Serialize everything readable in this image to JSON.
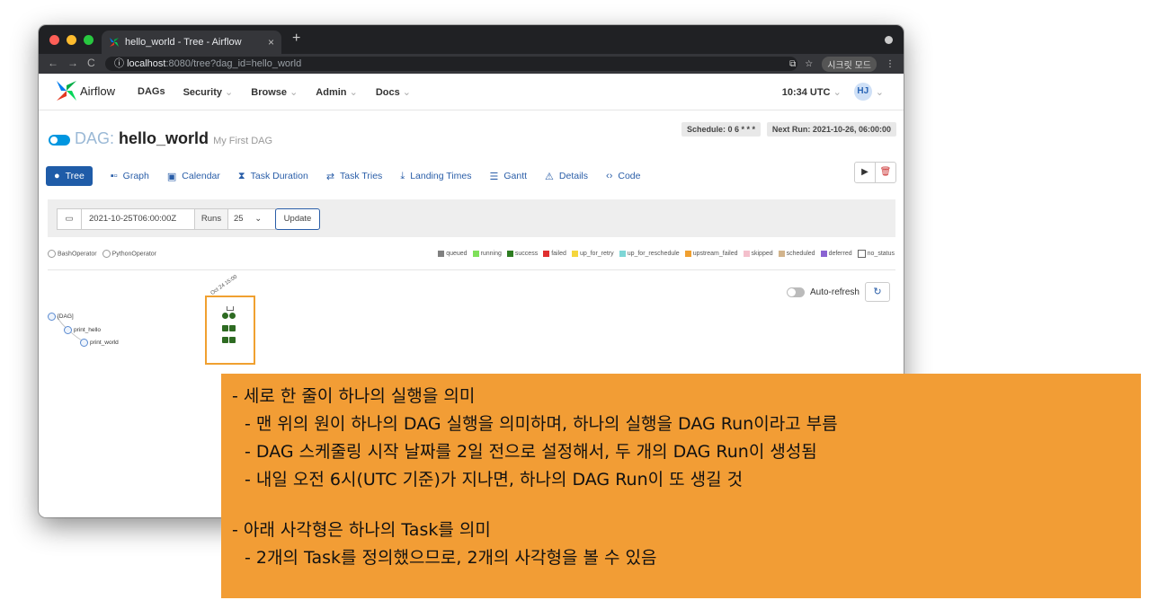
{
  "browser": {
    "tab_title": "hello_world - Tree - Airflow",
    "tab_close": "×",
    "new_tab": "+",
    "url_host": "localhost",
    "url_path": ":8080/tree?dag_id=hello_world",
    "incognito_label": "시크릿 모드"
  },
  "navbar": {
    "logo_text": "Airflow",
    "menu": [
      "DAGs",
      "Security",
      "Browse",
      "Admin",
      "Docs"
    ],
    "time": "10:34 UTC",
    "user_initials": "HJ"
  },
  "dag": {
    "label": "DAG:",
    "name": "hello_world",
    "description": "My First DAG",
    "schedule": "Schedule: 0 6 * * *",
    "next_run": "Next Run: 2021-10-26, 06:00:00"
  },
  "tabs": [
    "Tree",
    "Graph",
    "Calendar",
    "Task Duration",
    "Task Tries",
    "Landing Times",
    "Gantt",
    "Details",
    "Code"
  ],
  "form": {
    "date": "2021-10-25T06:00:00Z",
    "runs_label": "Runs",
    "runs_value": "25",
    "update_label": "Update"
  },
  "operators": [
    "BashOperator",
    "PythonOperator"
  ],
  "legend": [
    {
      "label": "queued",
      "color": "#808080"
    },
    {
      "label": "running",
      "color": "#7fe05a"
    },
    {
      "label": "success",
      "color": "#2e7d22"
    },
    {
      "label": "failed",
      "color": "#e03030"
    },
    {
      "label": "up_for_retry",
      "color": "#f5d63d"
    },
    {
      "label": "up_for_reschedule",
      "color": "#7ed6d6"
    },
    {
      "label": "upstream_failed",
      "color": "#f0a030"
    },
    {
      "label": "skipped",
      "color": "#f4c0cc"
    },
    {
      "label": "scheduled",
      "color": "#d2b48c"
    },
    {
      "label": "deferred",
      "color": "#8a63d2"
    },
    {
      "label": "no_status",
      "color": "#ffffff"
    }
  ],
  "tree": {
    "dag_node": "[DAG]",
    "task1": "print_hello",
    "task2": "print_world",
    "run_date": "Oct 24 15:00"
  },
  "auto_refresh_label": "Auto-refresh",
  "annotation": {
    "line1": "- 세로 한 줄이 하나의 실행을 의미",
    "line2": "- 맨 위의 원이 하나의 DAG 실행을 의미하며, 하나의 실행을 DAG Run이라고 부름",
    "line3": "- DAG 스케줄링 시작 날짜를 2일 전으로 설정해서, 두 개의 DAG Run이 생성됨",
    "line4": "- 내일 오전 6시(UTC 기준)가 지나면, 하나의 DAG Run이 또 생길 것",
    "line5": "- 아래 사각형은 하나의 Task를 의미",
    "line6": "- 2개의 Task를 정의했으므로, 2개의 사각형을 볼 수 있음"
  }
}
